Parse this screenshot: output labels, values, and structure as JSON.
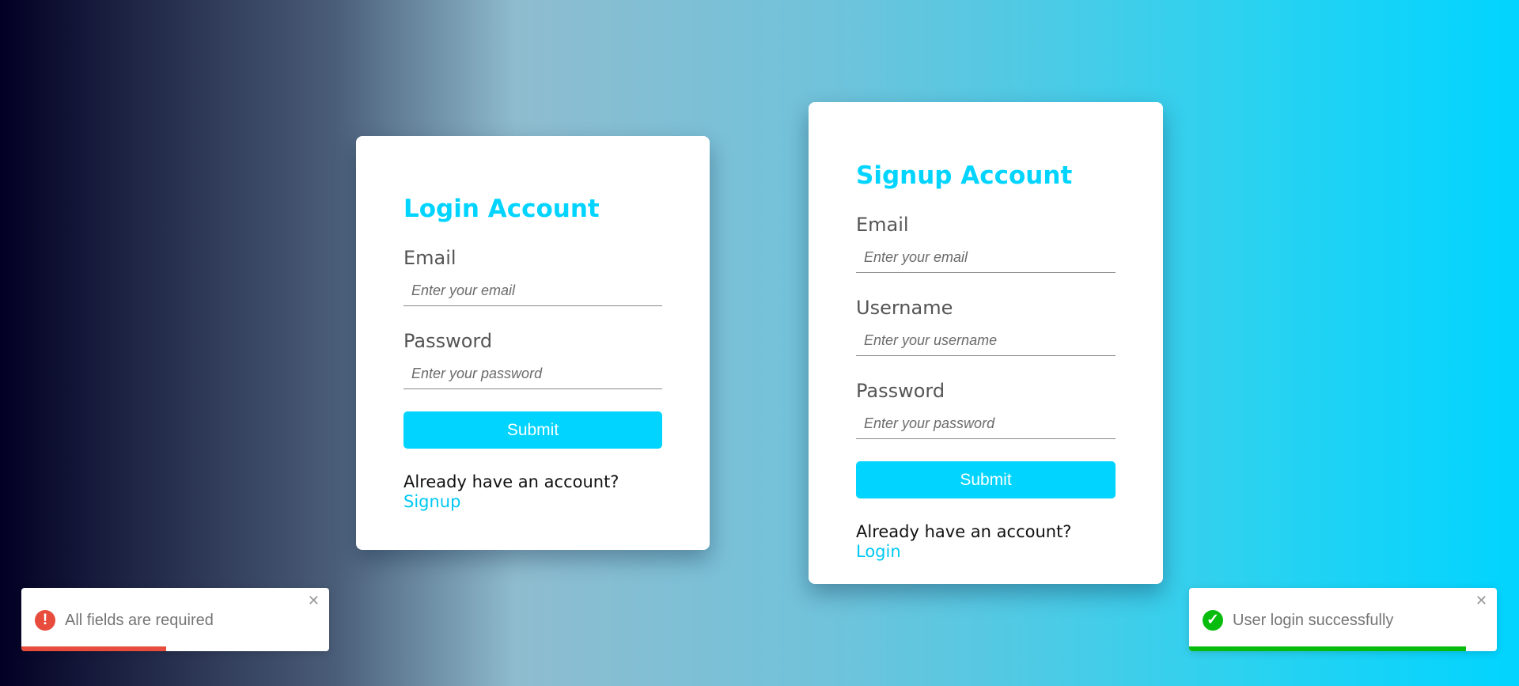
{
  "login": {
    "title": "Login Account",
    "email_label": "Email",
    "email_placeholder": "Enter your email",
    "password_label": "Password",
    "password_placeholder": "Enter your password",
    "submit_label": "Submit",
    "footer_text": "Already have an account?",
    "footer_link": "Signup"
  },
  "signup": {
    "title": "Signup Account",
    "email_label": "Email",
    "email_placeholder": "Enter your email",
    "username_label": "Username",
    "username_placeholder": "Enter your username",
    "password_label": "Password",
    "password_placeholder": "Enter your password",
    "submit_label": "Submit",
    "footer_text": "Already have an account?",
    "footer_link": "Login"
  },
  "toasts": {
    "error": {
      "icon": "exclamation-icon",
      "icon_glyph": "!",
      "message": "All fields are required",
      "close_glyph": "✕",
      "progress": 0.47,
      "color": "#e74c3c"
    },
    "success": {
      "icon": "checkmark-icon",
      "icon_glyph": "✓",
      "message": "User login successfully",
      "close_glyph": "✕",
      "progress": 0.9,
      "color": "#07bc0c"
    }
  },
  "colors": {
    "accent": "#00d4ff",
    "gradient_start": "#020024",
    "gradient_end": "#00d4ff"
  }
}
